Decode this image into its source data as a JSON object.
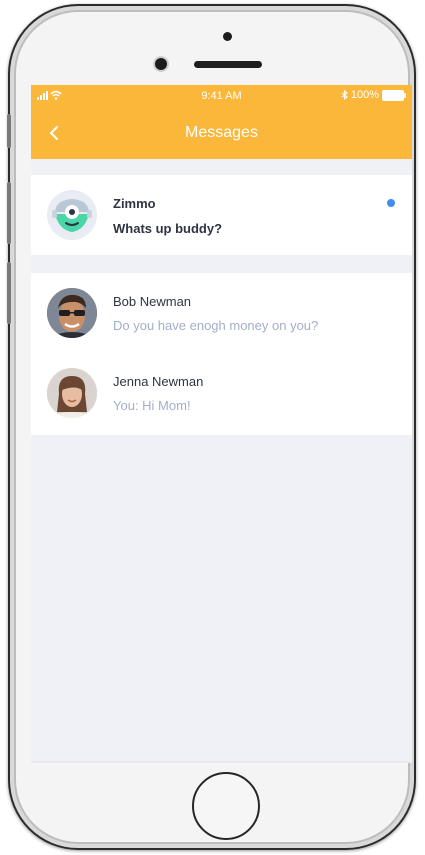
{
  "status_bar": {
    "signal": "▎▎▎",
    "time": "9:41 AM",
    "battery": "100%",
    "bluetooth_icon": "bluetooth-icon"
  },
  "header": {
    "title": "Messages",
    "back_icon": "chevron-left-icon"
  },
  "colors": {
    "accent": "#fbb73a",
    "unread": "#3f8ef5",
    "background": "#eff1f7"
  },
  "conversations": [
    {
      "name": "Zimmo",
      "message": "Whats up buddy?",
      "unread": true
    },
    {
      "name": "Bob Newman",
      "message": "Do you have enogh money on you?",
      "unread": false
    },
    {
      "name": "Jenna Newman",
      "message": "You: Hi Mom!",
      "unread": false
    }
  ]
}
